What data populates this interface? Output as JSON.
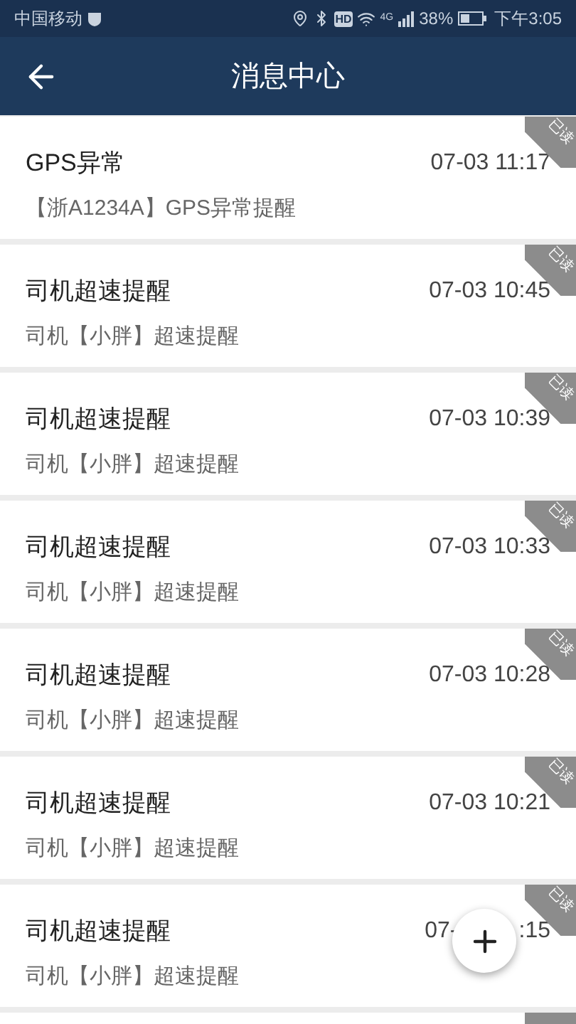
{
  "status_bar": {
    "carrier": "中国移动",
    "hd": "HD",
    "network": "4G",
    "battery": "38%",
    "time": "下午3:05"
  },
  "header": {
    "title": "消息中心"
  },
  "messages": [
    {
      "title": "GPS异常",
      "time": "07-03 11:17",
      "body": "【浙A1234A】GPS异常提醒",
      "read": true,
      "read_label": "已读"
    },
    {
      "title": "司机超速提醒",
      "time": "07-03 10:45",
      "body": "司机【小胖】超速提醒",
      "read": true,
      "read_label": "已读"
    },
    {
      "title": "司机超速提醒",
      "time": "07-03 10:39",
      "body": "司机【小胖】超速提醒",
      "read": true,
      "read_label": "已读"
    },
    {
      "title": "司机超速提醒",
      "time": "07-03 10:33",
      "body": "司机【小胖】超速提醒",
      "read": true,
      "read_label": "已读"
    },
    {
      "title": "司机超速提醒",
      "time": "07-03 10:28",
      "body": "司机【小胖】超速提醒",
      "read": true,
      "read_label": "已读"
    },
    {
      "title": "司机超速提醒",
      "time": "07-03 10:21",
      "body": "司机【小胖】超速提醒",
      "read": true,
      "read_label": "已读"
    },
    {
      "title": "司机超速提醒",
      "time": "07-",
      "time_end": ":15",
      "body": "司机【小胖】超速提醒",
      "read": true,
      "read_label": "已读"
    }
  ]
}
